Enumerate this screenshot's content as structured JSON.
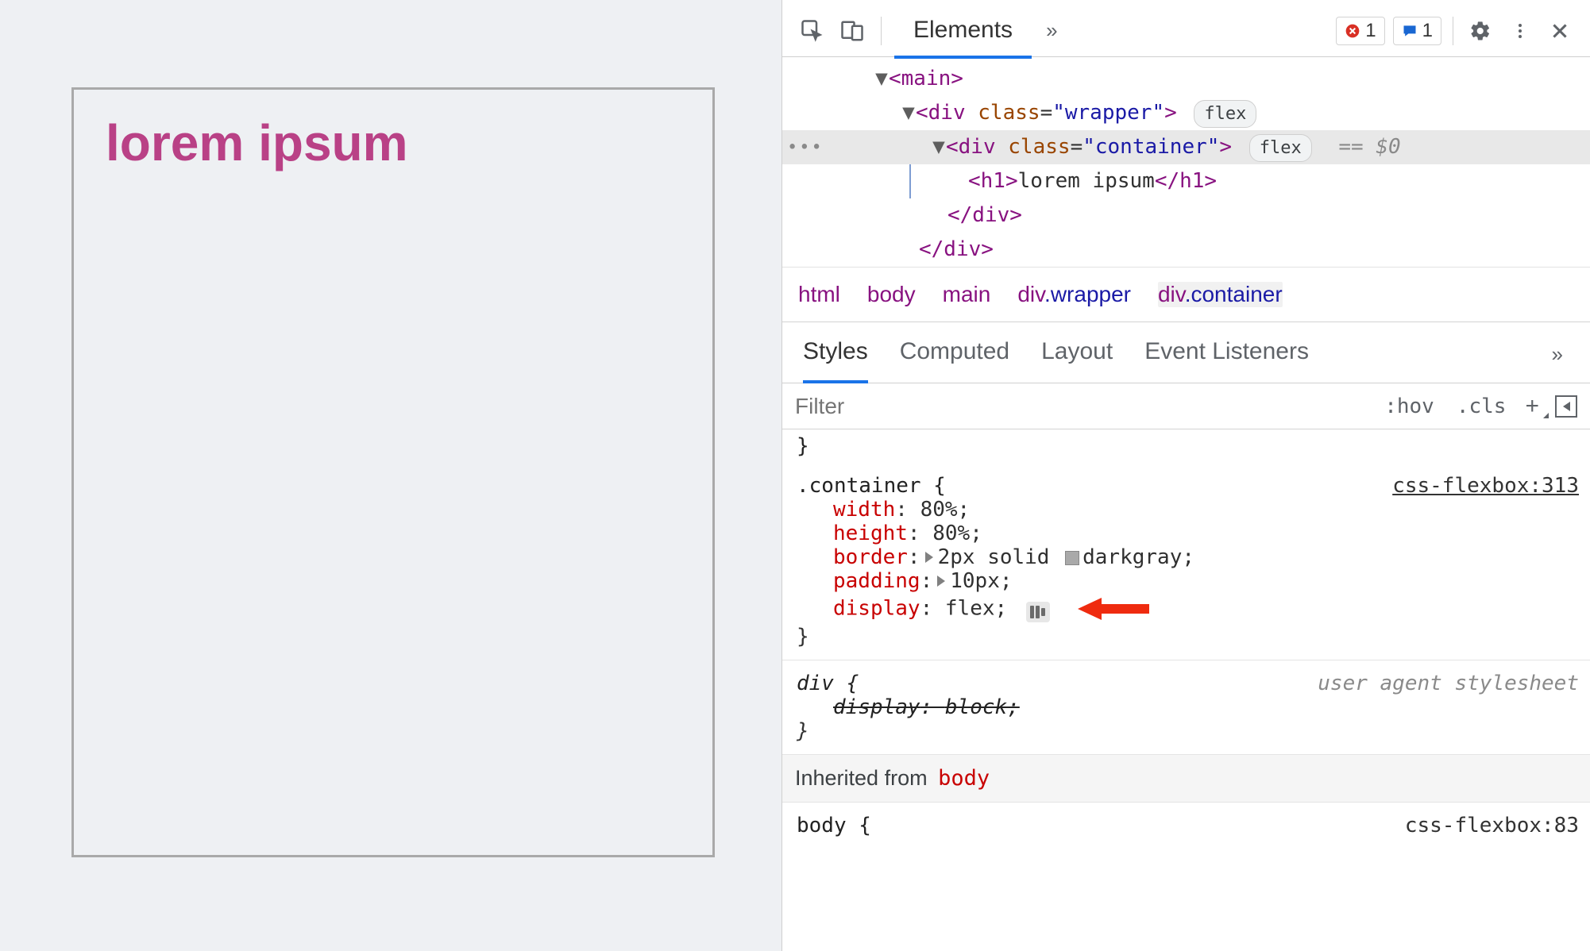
{
  "page": {
    "heading": "lorem ipsum"
  },
  "toolbar": {
    "tabs": {
      "elements": "Elements"
    },
    "error_count": "1",
    "message_count": "1"
  },
  "dom": {
    "main_open": "<main>",
    "wrapper_open1": "<div",
    "wrapper_cls_attr": "class",
    "wrapper_cls_val": "\"wrapper\"",
    "wrapper_close_sym": ">",
    "wrapper_badge": "flex",
    "container_open": "<div",
    "container_cls_attr": "class",
    "container_cls_val": "\"container\"",
    "container_badge": "flex",
    "selected_marker": "== $0",
    "h1_open": "<h1>",
    "h1_text": "lorem ipsum",
    "h1_close": "</h1>",
    "div_close1": "</div>",
    "div_close2": "</div>"
  },
  "breadcrumb": {
    "a": "html",
    "b": "body",
    "c": "main",
    "d": "div",
    "d_cls": ".wrapper",
    "e": "div",
    "e_cls": ".container"
  },
  "subtabs": {
    "styles": "Styles",
    "computed": "Computed",
    "layout": "Layout",
    "events": "Event Listeners"
  },
  "filter": {
    "placeholder": "Filter",
    "hov": ":hov",
    "cls": ".cls"
  },
  "rules": {
    "container": {
      "selector": ".container {",
      "source": "css-flexbox:313",
      "p_width": "width",
      "v_width": "80%;",
      "p_height": "height",
      "v_height": "80%;",
      "p_border": "border",
      "v_border_a": "2px solid",
      "v_border_b": "darkgray;",
      "p_padding": "padding",
      "v_padding": "10px;",
      "p_display": "display",
      "v_display": "flex;",
      "close": "}"
    },
    "div": {
      "selector": "div {",
      "source": "user agent stylesheet",
      "p_display": "display",
      "v_display": "block;",
      "close": "}"
    },
    "inherited_from": "Inherited from",
    "inherited_sel": "body",
    "partial_selector": "body {",
    "partial_source": "css-flexbox:83"
  }
}
